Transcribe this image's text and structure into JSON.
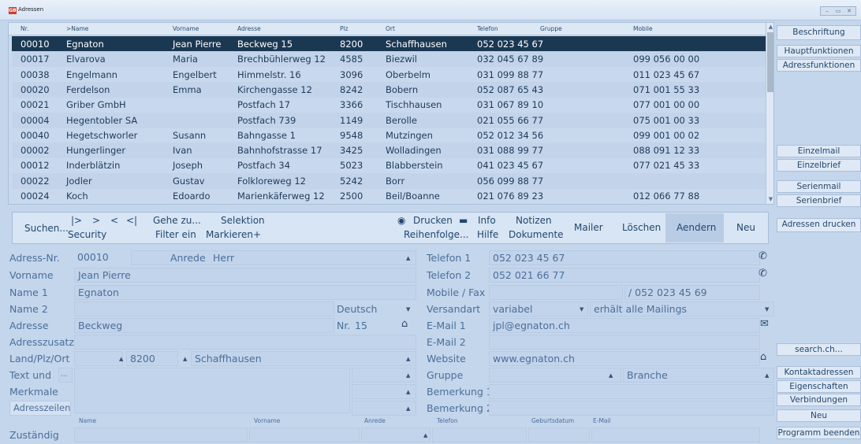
{
  "window": {
    "title": "Adressen",
    "icon_text": "GB"
  },
  "columns": [
    "Nr.",
    ">Name",
    "Vorname",
    "Adresse",
    "Plz",
    "Ort",
    "Telefon",
    "Gruppe",
    "Mobile"
  ],
  "rows": [
    [
      "00010",
      "Egnaton",
      "Jean Pierre",
      "Beckweg 15",
      "8200",
      "Schaffhausen",
      "052 023 45 67",
      "",
      ""
    ],
    [
      "00017",
      "Elvarova",
      "Maria",
      "Brechbühlerweg 12",
      "4585",
      "Biezwil",
      "032 045 67 89",
      "",
      "099 056 00 00"
    ],
    [
      "00038",
      "Engelmann",
      "Engelbert",
      "Himmelstr. 16",
      "3096",
      "Oberbelm",
      "031 099 88 77",
      "",
      "011 023 45 67"
    ],
    [
      "00020",
      "Ferdelson",
      "Emma",
      "Kirchengasse 12",
      "8242",
      "Bobern",
      "052 087 65 43",
      "",
      "071 001 55 33"
    ],
    [
      "00021",
      "Griber GmbH",
      "",
      "Postfach 17",
      "3366",
      "Tischhausen",
      "031 067 89 10",
      "",
      "077 001 00 00"
    ],
    [
      "00004",
      "Hegentobler SA",
      "",
      "Postfach 739",
      "1149",
      "Berolle",
      "021 055 66 77",
      "",
      "075 001 00 33"
    ],
    [
      "00040",
      "Hegetschworler",
      "Susann",
      "Bahngasse 1",
      "9548",
      "Mutzingen",
      "052 012 34 56",
      "",
      "099 001 00 02"
    ],
    [
      "00002",
      "Hungerlinger",
      "Ivan",
      "Bahnhofstrasse 17",
      "3425",
      "Wolladingen",
      "031 088 99 77",
      "",
      "088 091 12 33"
    ],
    [
      "00012",
      "Inderblätzin",
      "Joseph",
      "Postfach 34",
      "5023",
      "Blabberstein",
      "041 023 45 67",
      "",
      "077 021 45 33"
    ],
    [
      "00022",
      "Jodler",
      "Gustav",
      "Folkloreweg 12",
      "5242",
      "Borr",
      "056 099 88 77",
      "",
      ""
    ],
    [
      "00024",
      "Koch",
      "Edoardo",
      "Marienkäferweg 12",
      "2500",
      "Beil/Boanne",
      "021 076 89 23",
      "",
      "012 066 77 88"
    ]
  ],
  "toolbar": {
    "suchen": "Suchen...",
    "nav_first": "|>",
    "nav_next": ">",
    "nav_prev": "<",
    "nav_last": "<|",
    "gehe_zu": "Gehe zu...",
    "selektion": "Selektion",
    "security": "Security",
    "filter_ein": "Filter ein",
    "markieren": "Markieren+",
    "drucken": "Drucken",
    "info": "Info",
    "notizen": "Notizen",
    "reihenfolge": "Reihenfolge...",
    "hilfe": "Hilfe",
    "dokumente": "Dokumente",
    "mailer": "Mailer",
    "loeschen": "Löschen",
    "aendern": "Aendern",
    "neu": "Neu"
  },
  "form": {
    "adress_nr_label": "Adress-Nr.",
    "adress_nr": "00010",
    "anrede_label": "Anrede",
    "anrede": "Herr",
    "vorname_label": "Vorname",
    "vorname": "Jean Pierre",
    "name1_label": "Name 1",
    "name1": "Egnaton",
    "name2_label": "Name 2",
    "name2": "",
    "sprache": "Deutsch",
    "adresse_label": "Adresse",
    "adresse": "Beckweg",
    "nr_label": "Nr.",
    "nr": "15",
    "adresszusatz_label": "Adresszusatz",
    "adresszusatz": "",
    "land_plz_ort_label": "Land/Plz/Ort",
    "plz": "8200",
    "ort": "Schaffhausen",
    "text_und_label": "Text und",
    "dots": "...",
    "merkmale_label": "Merkmale",
    "adresszeilen": "Adresszeilen",
    "telefon1_label": "Telefon 1",
    "telefon1": "052 023 45 67",
    "telefon2_label": "Telefon 2",
    "telefon2": "052 021 66 77",
    "mobile_fax_label": "Mobile / Fax",
    "fax": "/ 052 023 45 69",
    "versandart_label": "Versandart",
    "versandart": "variabel",
    "mailings": "erhält alle Mailings",
    "email1_label": "E-Mail 1",
    "email1": "jpl@egnaton.ch",
    "email2_label": "E-Mail 2",
    "email2": "",
    "website_label": "Website",
    "website": "www.egnaton.ch",
    "gruppe_label": "Gruppe",
    "gruppe": "",
    "branche": "Branche",
    "bemerkung1_label": "Bemerkung 1",
    "bemerkung2_label": "Bemerkung 2",
    "zustaendig_label": "Zuständig",
    "sub_headers": [
      "Name",
      "Vorname",
      "Anrede",
      "Telefon",
      "Geburtsdatum",
      "E-Mail"
    ]
  },
  "side": [
    "Beschriftung",
    "Hauptfunktionen",
    "Adressfunktionen",
    "Einzelmail",
    "Einzelbrief",
    "Serienmail",
    "Serienbrief",
    "Adressen drucken",
    "search.ch...",
    "Kontaktadressen",
    "Eigenschaften",
    "Verbindungen",
    "Neu",
    "Programm beenden"
  ]
}
